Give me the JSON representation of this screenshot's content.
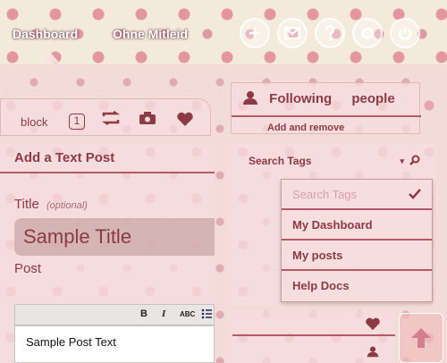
{
  "nav": {
    "dashboard": "Dashboard",
    "blog": "Ohne Mitleid"
  },
  "icons": [
    "plus-icon",
    "mail-icon",
    "help-icon",
    "settings-icon",
    "power-icon"
  ],
  "postbar": {
    "label": "block",
    "count": "1"
  },
  "following": {
    "label": "Following",
    "people": "people",
    "sub": "Add and remove"
  },
  "editor": {
    "heading": "Add a Text Post",
    "title_label": "Title",
    "title_optional": "(optional)",
    "title_value": "Sample Title",
    "post_label": "Post",
    "toolbar": {
      "bold": "B",
      "italic": "I",
      "strike": "ABC"
    },
    "body": "Sample Post Text"
  },
  "search": {
    "label": "Search Tags",
    "caret": "▾"
  },
  "dropdown": {
    "items": [
      "Search Tags",
      "My Dashboard",
      "My posts",
      "Help Docs"
    ]
  },
  "colors": {
    "accent": "#8c3a45",
    "divider": "#b2596a",
    "panel": "#f6dddd"
  }
}
